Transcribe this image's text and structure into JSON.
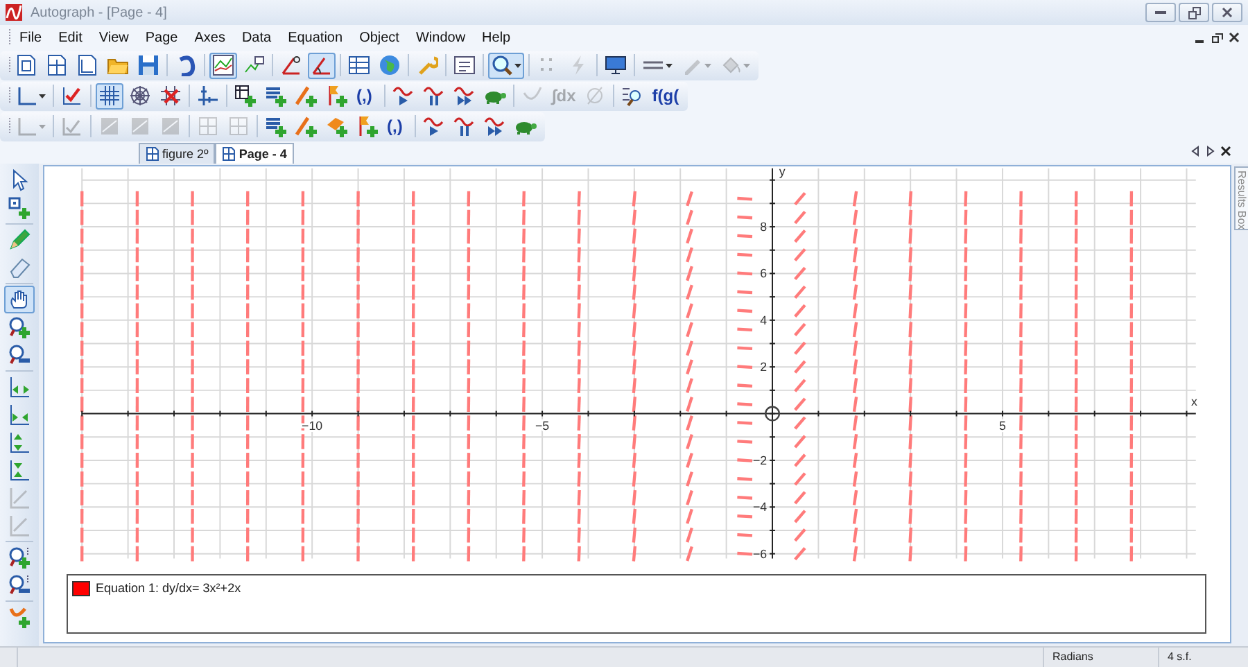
{
  "window": {
    "title": "Autograph - [Page - 4]"
  },
  "menu": [
    {
      "label": "File"
    },
    {
      "label": "Edit"
    },
    {
      "label": "View"
    },
    {
      "label": "Page"
    },
    {
      "label": "Axes"
    },
    {
      "label": "Data"
    },
    {
      "label": "Equation"
    },
    {
      "label": "Object"
    },
    {
      "label": "Window"
    },
    {
      "label": "Help"
    }
  ],
  "toolbars": [
    [
      {
        "kind": "sigma-page",
        "selected": false,
        "disabled": false
      },
      {
        "kind": "page",
        "selected": false,
        "disabled": false
      },
      {
        "kind": "page-graph",
        "selected": false,
        "disabled": false
      },
      {
        "kind": "folder",
        "selected": false,
        "disabled": false
      },
      {
        "kind": "save",
        "selected": false,
        "disabled": false
      },
      {
        "kind": "separator"
      },
      {
        "kind": "undo",
        "selected": false,
        "disabled": false
      },
      {
        "kind": "separator"
      },
      {
        "kind": "line-graph",
        "selected": true,
        "disabled": false
      },
      {
        "kind": "chart",
        "selected": false,
        "disabled": false
      },
      {
        "kind": "separator"
      },
      {
        "kind": "angle",
        "selected": false,
        "disabled": false
      },
      {
        "kind": "angle-arc",
        "selected": true,
        "disabled": false
      },
      {
        "kind": "separator"
      },
      {
        "kind": "table",
        "selected": false,
        "disabled": false
      },
      {
        "kind": "globe",
        "selected": false,
        "disabled": false
      },
      {
        "kind": "separator"
      },
      {
        "kind": "wrench",
        "selected": false,
        "disabled": false
      },
      {
        "kind": "separator"
      },
      {
        "kind": "text-box",
        "selected": false,
        "disabled": false
      },
      {
        "kind": "separator"
      },
      {
        "kind": "magnifier",
        "selected": true,
        "disabled": false,
        "dropdown": true
      },
      {
        "kind": "separator"
      },
      {
        "kind": "scatter",
        "selected": false,
        "disabled": true
      },
      {
        "kind": "lightning",
        "selected": false,
        "disabled": true
      },
      {
        "kind": "separator"
      },
      {
        "kind": "monitor",
        "selected": false,
        "disabled": false
      },
      {
        "kind": "separator"
      },
      {
        "kind": "line-style",
        "selected": false,
        "disabled": false,
        "dropdown": true
      },
      {
        "kind": "pen",
        "selected": false,
        "disabled": true,
        "dropdown": true
      },
      {
        "kind": "bucket",
        "selected": false,
        "disabled": true,
        "dropdown": true
      }
    ],
    [
      {
        "kind": "axes",
        "selected": false,
        "disabled": false,
        "dropdown": true
      },
      {
        "kind": "separator"
      },
      {
        "kind": "check",
        "selected": false,
        "disabled": false
      },
      {
        "kind": "separator"
      },
      {
        "kind": "grid",
        "selected": true,
        "disabled": false
      },
      {
        "kind": "polar-grid",
        "selected": false,
        "disabled": false
      },
      {
        "kind": "grid-cross",
        "selected": false,
        "disabled": false
      },
      {
        "kind": "separator"
      },
      {
        "kind": "axes-ticks",
        "selected": false,
        "disabled": false
      },
      {
        "kind": "separator"
      },
      {
        "kind": "table-plus",
        "selected": false,
        "disabled": false
      },
      {
        "kind": "equation-plus",
        "selected": false,
        "disabled": false
      },
      {
        "kind": "line-plus",
        "selected": false,
        "disabled": false
      },
      {
        "kind": "flag-plus",
        "selected": false,
        "disabled": false
      },
      {
        "kind": "text",
        "label": "(,)",
        "selected": false,
        "disabled": false
      },
      {
        "kind": "separator"
      },
      {
        "kind": "wave-play",
        "selected": false,
        "disabled": false
      },
      {
        "kind": "wave-pause",
        "selected": false,
        "disabled": false
      },
      {
        "kind": "wave-ff",
        "selected": false,
        "disabled": false
      },
      {
        "kind": "turtle",
        "selected": false,
        "disabled": false
      },
      {
        "kind": "separator"
      },
      {
        "kind": "curve",
        "selected": false,
        "disabled": true
      },
      {
        "kind": "text",
        "label": "∫dx",
        "selected": false,
        "disabled": true
      },
      {
        "kind": "circle-slash",
        "selected": false,
        "disabled": true
      },
      {
        "kind": "separator"
      },
      {
        "kind": "list-magnifier",
        "selected": false,
        "disabled": false
      },
      {
        "kind": "text",
        "label": "f(g(",
        "selected": false,
        "disabled": false
      }
    ],
    [
      {
        "kind": "axes",
        "selected": false,
        "disabled": true,
        "dropdown": true
      },
      {
        "kind": "separator"
      },
      {
        "kind": "check-axes",
        "selected": false,
        "disabled": true
      },
      {
        "kind": "separator"
      },
      {
        "kind": "shaded-axes",
        "selected": false,
        "disabled": true
      },
      {
        "kind": "shaded-axes",
        "selected": false,
        "disabled": true
      },
      {
        "kind": "shaded-axes",
        "selected": false,
        "disabled": true
      },
      {
        "kind": "separator"
      },
      {
        "kind": "grid-box",
        "selected": false,
        "disabled": true
      },
      {
        "kind": "grid-box",
        "selected": false,
        "disabled": true
      },
      {
        "kind": "separator"
      },
      {
        "kind": "equation-plus",
        "selected": false,
        "disabled": false
      },
      {
        "kind": "line-plus",
        "selected": false,
        "disabled": false
      },
      {
        "kind": "plane-plus",
        "selected": false,
        "disabled": false
      },
      {
        "kind": "flag-plus",
        "selected": false,
        "disabled": false
      },
      {
        "kind": "text",
        "label": "(,)",
        "selected": false,
        "disabled": false
      },
      {
        "kind": "separator"
      },
      {
        "kind": "wave-play",
        "selected": false,
        "disabled": false
      },
      {
        "kind": "wave-pause",
        "selected": false,
        "disabled": false
      },
      {
        "kind": "wave-ff",
        "selected": false,
        "disabled": false
      },
      {
        "kind": "turtle",
        "selected": false,
        "disabled": false
      }
    ]
  ],
  "side_toolbar": [
    {
      "kind": "pointer",
      "selected": false,
      "disabled": false
    },
    {
      "kind": "point-plus",
      "selected": false,
      "disabled": false
    },
    {
      "kind": "separator"
    },
    {
      "kind": "pencil",
      "selected": false,
      "disabled": false
    },
    {
      "kind": "eraser",
      "selected": false,
      "disabled": false
    },
    {
      "kind": "separator"
    },
    {
      "kind": "hand",
      "selected": true,
      "disabled": false
    },
    {
      "kind": "zoom-in",
      "selected": false,
      "disabled": false
    },
    {
      "kind": "zoom-out",
      "selected": false,
      "disabled": false
    },
    {
      "kind": "separator"
    },
    {
      "kind": "stretch-x",
      "selected": false,
      "disabled": false
    },
    {
      "kind": "shrink-x",
      "selected": false,
      "disabled": false
    },
    {
      "kind": "stretch-y",
      "selected": false,
      "disabled": false
    },
    {
      "kind": "shrink-y",
      "selected": false,
      "disabled": false
    },
    {
      "kind": "axes-stretch",
      "selected": false,
      "disabled": true
    },
    {
      "kind": "axes-stretch",
      "selected": false,
      "disabled": true
    },
    {
      "kind": "separator"
    },
    {
      "kind": "zoom-in-scale",
      "selected": false,
      "disabled": false
    },
    {
      "kind": "zoom-out-scale",
      "selected": false,
      "disabled": false
    },
    {
      "kind": "separator"
    },
    {
      "kind": "curve-plus",
      "selected": false,
      "disabled": false
    }
  ],
  "tabs": [
    {
      "label": "figure 2º",
      "selected": false
    },
    {
      "label": "Page - 4",
      "selected": true
    }
  ],
  "graph": {
    "x_axis_label": "x",
    "y_axis_label": "y",
    "x_tick_labels": [
      "−10",
      "−5",
      "5"
    ],
    "y_tick_labels": [
      "8",
      "6",
      "4",
      "2",
      "−2",
      "−4",
      "−6"
    ]
  },
  "legend": [
    {
      "label": "Equation 1: dy/dx= 3x²+2x",
      "color": "#ff0000"
    }
  ],
  "results_tab": {
    "label": "Results Box"
  },
  "status_bar": {
    "angle_mode": "Radians",
    "precision": "4 s.f."
  }
}
